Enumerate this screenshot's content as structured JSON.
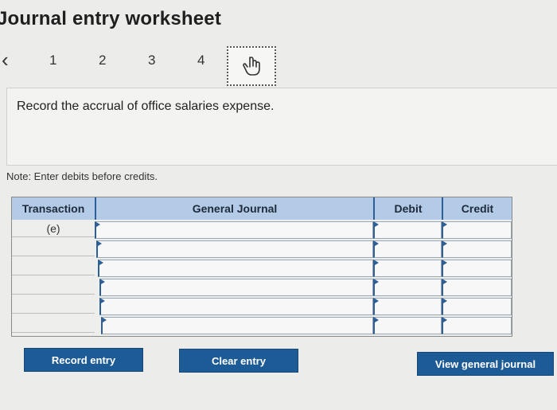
{
  "header": {
    "title": "Journal entry worksheet"
  },
  "steps": {
    "prev_icon": "chevron-left-icon",
    "items": [
      "1",
      "2",
      "3",
      "4"
    ],
    "current_icon": "hand-pointer-icon"
  },
  "instruction": "Record the accrual of office salaries expense.",
  "note": "Note: Enter debits before credits.",
  "journal": {
    "columns": [
      "Transaction",
      "General Journal",
      "Debit",
      "Credit"
    ],
    "rows": [
      {
        "transaction": "(e)",
        "account": "",
        "debit": "",
        "credit": ""
      },
      {
        "transaction": "",
        "account": "",
        "debit": "",
        "credit": ""
      },
      {
        "transaction": "",
        "account": "",
        "debit": "",
        "credit": ""
      },
      {
        "transaction": "",
        "account": "",
        "debit": "",
        "credit": ""
      },
      {
        "transaction": "",
        "account": "",
        "debit": "",
        "credit": ""
      },
      {
        "transaction": "",
        "account": "",
        "debit": "",
        "credit": ""
      }
    ]
  },
  "buttons": {
    "record": "Record entry",
    "clear": "Clear entry",
    "view": "View general journal"
  },
  "colors": {
    "accent": "#1d5b96",
    "header_bg": "#b3cbe6"
  }
}
